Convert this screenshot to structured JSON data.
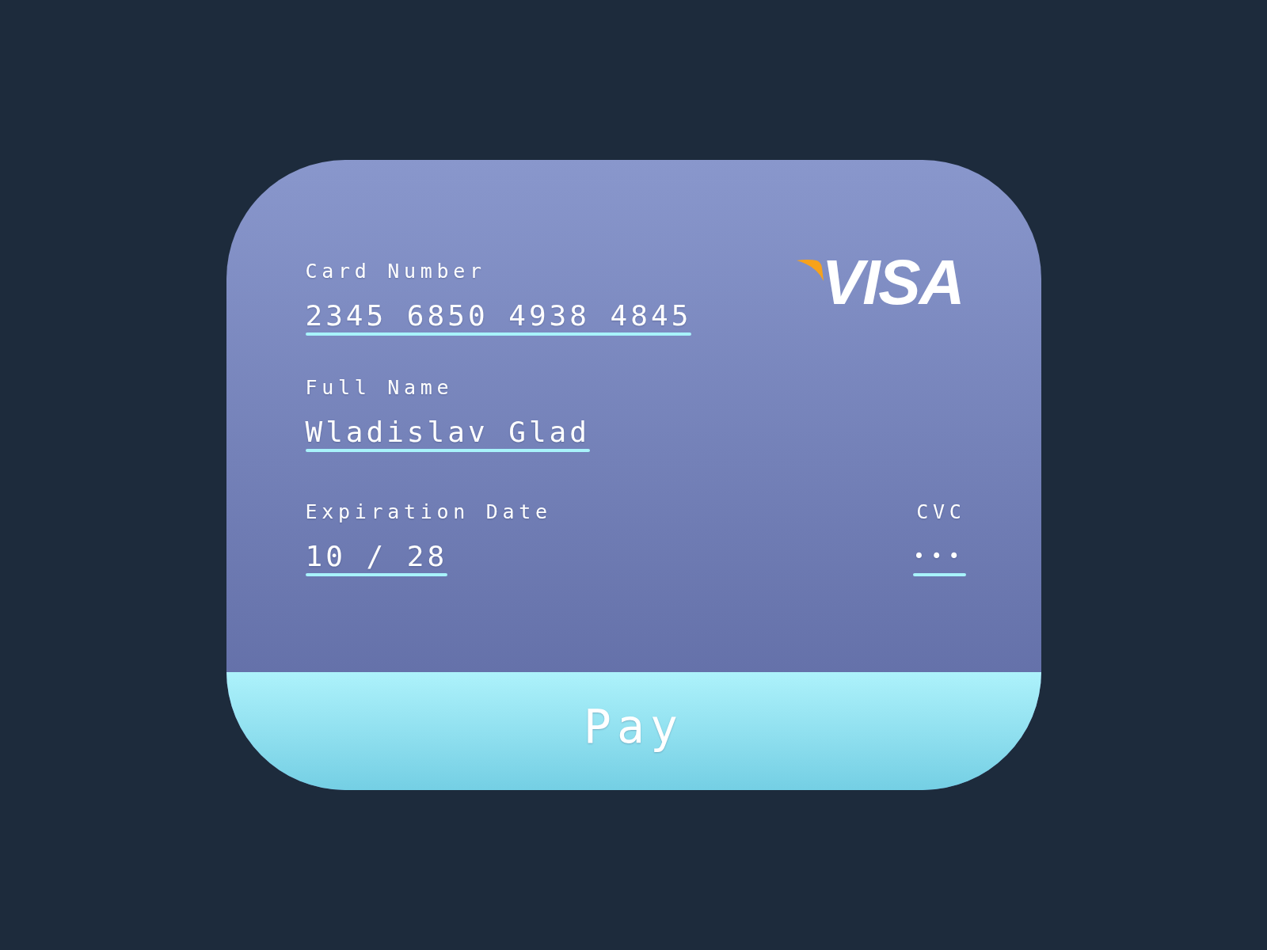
{
  "card": {
    "brand": "VISA",
    "card_number": {
      "label": "Card Number",
      "value": "2345 6850 4938 4845"
    },
    "full_name": {
      "label": "Full Name",
      "value": "Wladislav Glad"
    },
    "expiration_date": {
      "label": "Expiration Date",
      "value": "10 / 28"
    },
    "cvc": {
      "label": "CVC",
      "value": "•••"
    }
  },
  "pay_button": {
    "label": "Pay"
  }
}
